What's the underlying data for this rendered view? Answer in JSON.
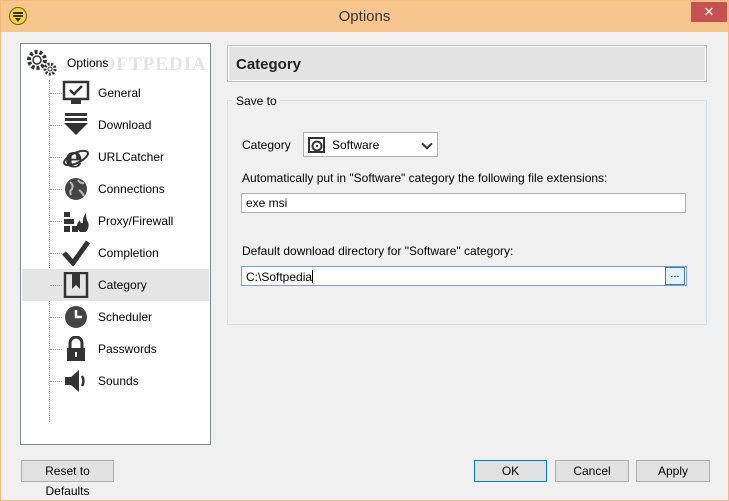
{
  "window": {
    "title": "Options",
    "close_glyph": "✕"
  },
  "tree": {
    "root_label": "Options",
    "watermark": "SOFTPEDIA",
    "items": [
      {
        "label": "General",
        "icon": "monitor-check-icon"
      },
      {
        "label": "Download",
        "icon": "download-arrow-icon"
      },
      {
        "label": "URLCatcher",
        "icon": "ie-logo-icon"
      },
      {
        "label": "Connections",
        "icon": "globe-icon"
      },
      {
        "label": "Proxy/Firewall",
        "icon": "firewall-icon"
      },
      {
        "label": "Completion",
        "icon": "checkmark-icon"
      },
      {
        "label": "Category",
        "icon": "bookmark-icon",
        "selected": true
      },
      {
        "label": "Scheduler",
        "icon": "clock-icon"
      },
      {
        "label": "Passwords",
        "icon": "padlock-icon"
      },
      {
        "label": "Sounds",
        "icon": "speaker-icon"
      }
    ]
  },
  "panel": {
    "heading": "Category",
    "group_title": "Save to",
    "category_label": "Category",
    "category_value": "Software",
    "extensions_label": "Automatically put in \"Software\" category the following file extensions:",
    "extensions_value": "exe msi",
    "directory_label": "Default download directory for \"Software\" category:",
    "directory_value": "C:\\Softpedia",
    "browse_label": "..."
  },
  "buttons": {
    "reset": "Reset to Defaults",
    "ok": "OK",
    "cancel": "Cancel",
    "apply": "Apply"
  },
  "colors": {
    "titlebar": "#f7c58e",
    "close": "#c75050",
    "selected_row": "#e5e5e5"
  }
}
